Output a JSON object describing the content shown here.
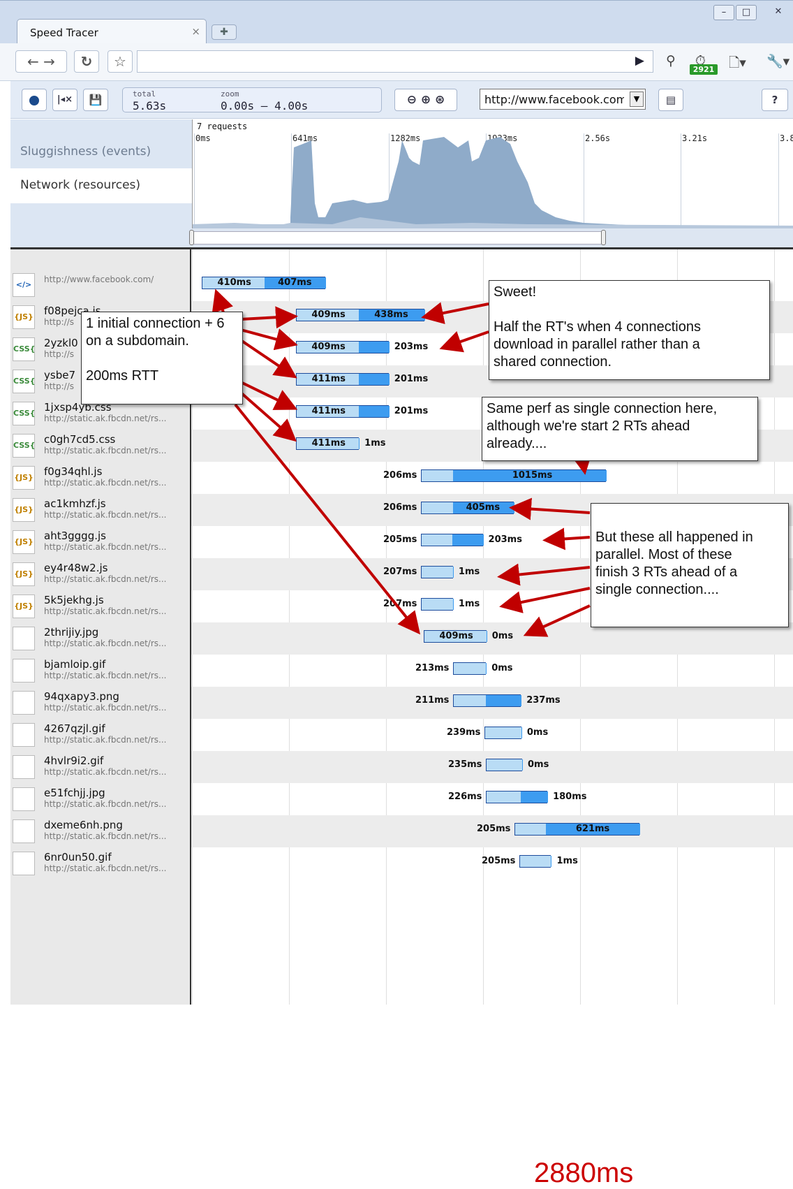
{
  "browser": {
    "tab_title": "Speed Tracer",
    "tab_close": "×",
    "new_tab": "✚",
    "window_min": "–",
    "window_max": "□",
    "window_close": "✕",
    "badge": "2921"
  },
  "toolbar": {
    "total_label": "total",
    "total_value": "5.63s",
    "zoom_label": "zoom",
    "zoom_value": "0.00s – 4.00s",
    "url_value": "http://www.facebook.com",
    "help": "?"
  },
  "overview": {
    "sluggishness_label": "Sluggishness (events)",
    "network_label": "Network (resources)",
    "request_count": "7 requests",
    "ticks": [
      "0ms",
      "641ms",
      "1282ms",
      "1923ms",
      "2.56s",
      "3.21s",
      "3.8"
    ]
  },
  "resources": [
    {
      "name": "",
      "url": "http://www.facebook.com/",
      "type": "HTML",
      "lat": 410,
      "dl": 407,
      "lat_label": "410ms",
      "dl_label": "407ms"
    },
    {
      "name": "f08pejca.js",
      "url": "http://s",
      "type": "JS",
      "lat": 409,
      "dl": 438,
      "lat_label": "409ms",
      "dl_label": "438ms"
    },
    {
      "name": "2yzkl0",
      "url": "http://s",
      "type": "CSS",
      "lat": 409,
      "dl": 203,
      "lat_label": "409ms",
      "dl_label": "203ms"
    },
    {
      "name": "ysbe7",
      "url": "http://s",
      "type": "CSS",
      "lat": 411,
      "dl": 201,
      "lat_label": "411ms",
      "dl_label": "201ms"
    },
    {
      "name": "1jxsp4yb.css",
      "url": "http://static.ak.fbcdn.net/rs...",
      "type": "CSS",
      "lat": 411,
      "dl": 201,
      "lat_label": "411ms",
      "dl_label": "201ms"
    },
    {
      "name": "c0gh7cd5.css",
      "url": "http://static.ak.fbcdn.net/rs...",
      "type": "CSS",
      "lat": 411,
      "dl": 1,
      "lat_label": "411ms",
      "dl_label": "1ms"
    },
    {
      "name": "f0g34qhl.js",
      "url": "http://static.ak.fbcdn.net/rs...",
      "type": "JS",
      "lat": 206,
      "dl": 1015,
      "lat_label": "206ms",
      "dl_label": "1015ms"
    },
    {
      "name": "ac1kmhzf.js",
      "url": "http://static.ak.fbcdn.net/rs...",
      "type": "JS",
      "lat": 206,
      "dl": 405,
      "lat_label": "206ms",
      "dl_label": "405ms"
    },
    {
      "name": "aht3gggg.js",
      "url": "http://static.ak.fbcdn.net/rs...",
      "type": "JS",
      "lat": 205,
      "dl": 203,
      "lat_label": "205ms",
      "dl_label": "203ms"
    },
    {
      "name": "ey4r48w2.js",
      "url": "http://static.ak.fbcdn.net/rs...",
      "type": "JS",
      "lat": 207,
      "dl": 1,
      "lat_label": "207ms",
      "dl_label": "1ms"
    },
    {
      "name": "5k5jekhg.js",
      "url": "http://static.ak.fbcdn.net/rs...",
      "type": "JS",
      "lat": 207,
      "dl": 1,
      "lat_label": "207ms",
      "dl_label": "1ms"
    },
    {
      "name": "2thrijiy.jpg",
      "url": "http://static.ak.fbcdn.net/rs...",
      "type": "IMG",
      "lat": 409,
      "dl": 0,
      "lat_label": "409ms",
      "dl_label": "0ms"
    },
    {
      "name": "bjamloip.gif",
      "url": "http://static.ak.fbcdn.net/rs...",
      "type": "IMG",
      "lat": 213,
      "dl": 0,
      "lat_label": "213ms",
      "dl_label": "0ms"
    },
    {
      "name": "94qxapy3.png",
      "url": "http://static.ak.fbcdn.net/rs...",
      "type": "IMG",
      "lat": 211,
      "dl": 237,
      "lat_label": "211ms",
      "dl_label": "237ms"
    },
    {
      "name": "4267qzjl.gif",
      "url": "http://static.ak.fbcdn.net/rs...",
      "type": "IMG",
      "lat": 239,
      "dl": 0,
      "lat_label": "239ms",
      "dl_label": "0ms"
    },
    {
      "name": "4hvlr9i2.gif",
      "url": "http://static.ak.fbcdn.net/rs...",
      "type": "IMG",
      "lat": 235,
      "dl": 0,
      "lat_label": "235ms",
      "dl_label": "0ms"
    },
    {
      "name": "e51fchjj.jpg",
      "url": "http://static.ak.fbcdn.net/rs...",
      "type": "IMG",
      "lat": 226,
      "dl": 180,
      "lat_label": "226ms",
      "dl_label": "180ms"
    },
    {
      "name": "dxeme6nh.png",
      "url": "http://static.ak.fbcdn.net/rs...",
      "type": "IMG",
      "lat": 205,
      "dl": 621,
      "lat_label": "205ms",
      "dl_label": "621ms"
    },
    {
      "name": "6nr0un50.gif",
      "url": "http://static.ak.fbcdn.net/rs...",
      "type": "IMG",
      "lat": 205,
      "dl": 1,
      "lat_label": "205ms",
      "dl_label": "1ms"
    }
  ],
  "callouts": {
    "c1_line1": "1 initial connection + 6",
    "c1_line2": "on a subdomain.",
    "c1_line3": "200ms RTT",
    "c2_line1": "Sweet!",
    "c2_line2": "Half the RT's when 4 connections",
    "c2_line3": "download in parallel rather than a",
    "c2_line4": "shared connection.",
    "c3_line1": "Same perf as single connection here,",
    "c3_line2": "although we're start 2 RTs ahead",
    "c3_line3": "already....",
    "c4_line1": "But these all happened in",
    "c4_line2": "parallel.  Most of these",
    "c4_line3": "finish 3 RTs ahead of a",
    "c4_line4": "single connection...."
  },
  "total_time": "2880ms",
  "colors": {
    "latency": "#b9dcf5",
    "download": "#3d9cf0",
    "arrow": "#c00000",
    "overview_fill": "#8fabc9"
  }
}
